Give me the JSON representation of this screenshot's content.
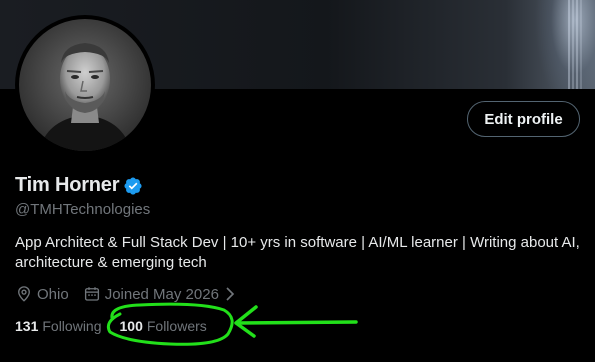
{
  "profile": {
    "name": "Tim Horner",
    "handle": "@TMHTechnologies",
    "bio": "App Architect & Full Stack Dev | 10+ yrs in software | AI/ML learner | Writing about AI, architecture & emerging tech",
    "location": "Ohio",
    "joined": "Joined May 2026",
    "edit_label": "Edit profile",
    "verified": true
  },
  "stats": {
    "following_count": "131",
    "following_label": "Following",
    "followers_count": "100",
    "followers_label": "Followers"
  },
  "icons": {
    "verified": "verified-badge-icon",
    "location": "location-pin-icon",
    "calendar": "calendar-icon",
    "chevron": "chevron-right-icon"
  },
  "colors": {
    "background": "#000000",
    "primary_text": "#e7e9ea",
    "secondary_text": "#71767b",
    "verified_blue": "#1d9bf0",
    "annotation_green": "#22e01a"
  }
}
